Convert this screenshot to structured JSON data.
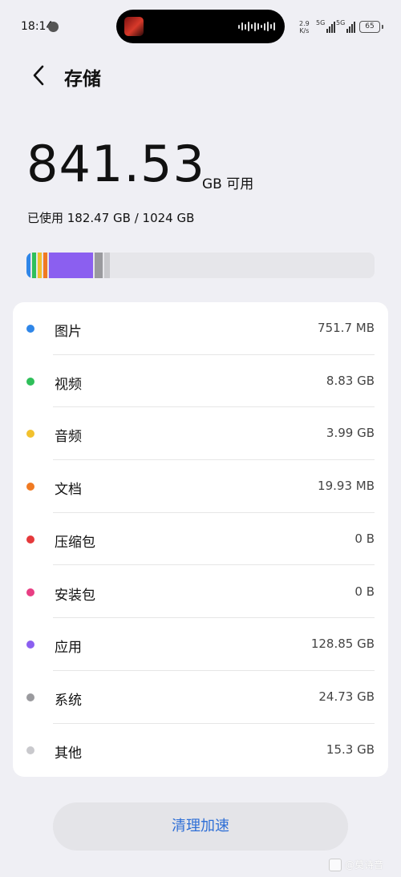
{
  "status_bar": {
    "time": "18:14",
    "net_speed_value": "2.9",
    "net_speed_unit": "K/s",
    "signal1": "5G",
    "signal2": "5G",
    "battery": "65"
  },
  "header": {
    "title": "存储"
  },
  "summary": {
    "available_value": "841.53",
    "available_unit": "GB 可用",
    "used_text": "已使用 182.47 GB / 1024 GB"
  },
  "storage_bar": {
    "track_color": "#e6e6ea",
    "segments": [
      {
        "name": "图片",
        "color": "#2f86e8",
        "fraction": 0.0007
      },
      {
        "name": "视频",
        "color": "#2fbf5a",
        "fraction": 0.0086
      },
      {
        "name": "音频",
        "color": "#f2c12e",
        "fraction": 0.0039
      },
      {
        "name": "文档",
        "color": "#f07a22",
        "fraction": 0.0002
      },
      {
        "name": "应用",
        "color": "#8b5ff0",
        "fraction": 0.1258
      },
      {
        "name": "系统",
        "color": "#9a9a9e",
        "fraction": 0.0242
      },
      {
        "name": "其他",
        "color": "#c9c9cd",
        "fraction": 0.0149
      }
    ]
  },
  "categories": [
    {
      "label": "图片",
      "size": "751.7 MB",
      "color": "#2f86e8"
    },
    {
      "label": "视频",
      "size": "8.83 GB",
      "color": "#2fbf5a"
    },
    {
      "label": "音频",
      "size": "3.99 GB",
      "color": "#f2c12e"
    },
    {
      "label": "文档",
      "size": "19.93 MB",
      "color": "#f07a22"
    },
    {
      "label": "压缩包",
      "size": "0 B",
      "color": "#e5393b"
    },
    {
      "label": "安装包",
      "size": "0 B",
      "color": "#e83e83"
    },
    {
      "label": "应用",
      "size": "128.85 GB",
      "color": "#8b5ff0"
    },
    {
      "label": "系统",
      "size": "24.73 GB",
      "color": "#9a9a9e"
    },
    {
      "label": "其他",
      "size": "15.3 GB",
      "color": "#c9c9cd"
    }
  ],
  "actions": {
    "clean_label": "清理加速"
  },
  "watermark": "@莫诗音"
}
